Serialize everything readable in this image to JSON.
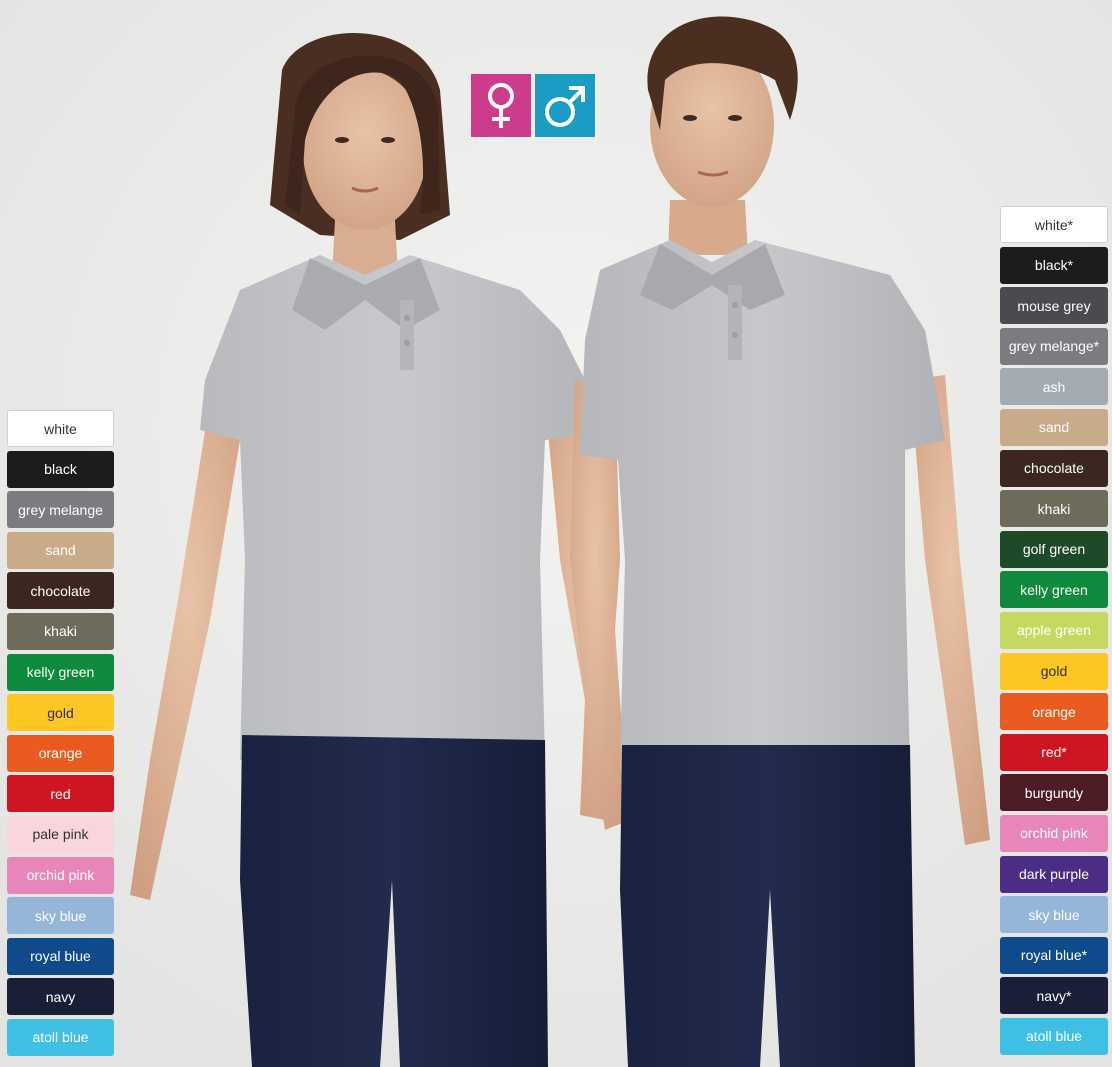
{
  "gender_icons": {
    "female": {
      "icon": "female-symbol-icon",
      "color": "#cc3b8c"
    },
    "male": {
      "icon": "male-symbol-icon",
      "color": "#1b9cc4"
    }
  },
  "female_colors": [
    {
      "label": "white",
      "bg": "#ffffff",
      "fg": "#333333"
    },
    {
      "label": "black",
      "bg": "#1c1d1b",
      "fg": "#ffffff"
    },
    {
      "label": "grey melange",
      "bg": "#7b7c80",
      "fg": "#ffffff"
    },
    {
      "label": "sand",
      "bg": "#c9ab8a",
      "fg": "#ffffff"
    },
    {
      "label": "chocolate",
      "bg": "#3b2720",
      "fg": "#ffffff"
    },
    {
      "label": "khaki",
      "bg": "#6e6b5a",
      "fg": "#ffffff"
    },
    {
      "label": "kelly green",
      "bg": "#0f8a3c",
      "fg": "#ffffff"
    },
    {
      "label": "gold",
      "bg": "#fcc623",
      "fg": "#333333"
    },
    {
      "label": "orange",
      "bg": "#ea5b1f",
      "fg": "#ffffff"
    },
    {
      "label": "red",
      "bg": "#cd1621",
      "fg": "#ffffff"
    },
    {
      "label": "pale pink",
      "bg": "#f8d6dc",
      "fg": "#333333"
    },
    {
      "label": "orchid pink",
      "bg": "#e786b8",
      "fg": "#ffffff"
    },
    {
      "label": "sky blue",
      "bg": "#95b6d9",
      "fg": "#ffffff"
    },
    {
      "label": "royal blue",
      "bg": "#0f4a8a",
      "fg": "#ffffff"
    },
    {
      "label": "navy",
      "bg": "#1a1e36",
      "fg": "#ffffff"
    },
    {
      "label": "atoll blue",
      "bg": "#3fbfe4",
      "fg": "#ffffff"
    }
  ],
  "male_colors": [
    {
      "label": "white*",
      "bg": "#ffffff",
      "fg": "#333333"
    },
    {
      "label": "black*",
      "bg": "#1c1d1b",
      "fg": "#ffffff"
    },
    {
      "label": "mouse grey",
      "bg": "#4a4b4f",
      "fg": "#ffffff"
    },
    {
      "label": "grey melange*",
      "bg": "#7b7c80",
      "fg": "#ffffff"
    },
    {
      "label": "ash",
      "bg": "#a3aab1",
      "fg": "#ffffff"
    },
    {
      "label": "sand",
      "bg": "#c9ab8a",
      "fg": "#ffffff"
    },
    {
      "label": "chocolate",
      "bg": "#3b2720",
      "fg": "#ffffff"
    },
    {
      "label": "khaki",
      "bg": "#6e6b5a",
      "fg": "#ffffff"
    },
    {
      "label": "golf green",
      "bg": "#1f4a2a",
      "fg": "#ffffff"
    },
    {
      "label": "kelly green",
      "bg": "#0f8a3c",
      "fg": "#ffffff"
    },
    {
      "label": "apple green",
      "bg": "#c5d860",
      "fg": "#ffffff"
    },
    {
      "label": "gold",
      "bg": "#fcc623",
      "fg": "#333333"
    },
    {
      "label": "orange",
      "bg": "#ea5b1f",
      "fg": "#ffffff"
    },
    {
      "label": "red*",
      "bg": "#cd1621",
      "fg": "#ffffff"
    },
    {
      "label": "burgundy",
      "bg": "#4d1d26",
      "fg": "#ffffff"
    },
    {
      "label": "orchid pink",
      "bg": "#e786b8",
      "fg": "#ffffff"
    },
    {
      "label": "dark purple",
      "bg": "#4c2d85",
      "fg": "#ffffff"
    },
    {
      "label": "sky blue",
      "bg": "#95b6d9",
      "fg": "#ffffff"
    },
    {
      "label": "royal blue*",
      "bg": "#0f4a8a",
      "fg": "#ffffff"
    },
    {
      "label": "navy*",
      "bg": "#1a1e36",
      "fg": "#ffffff"
    },
    {
      "label": "atoll blue",
      "bg": "#3fbfe4",
      "fg": "#ffffff"
    }
  ]
}
